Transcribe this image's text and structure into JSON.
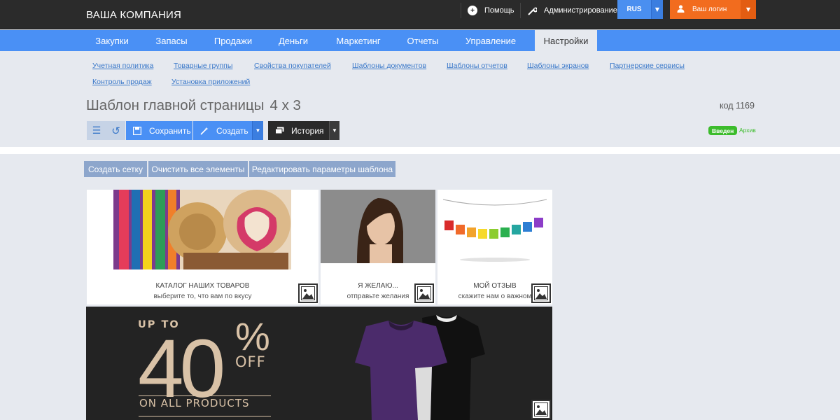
{
  "topbar": {
    "brand": "ВАША КОМПАНИЯ",
    "help_label": "Помощь",
    "admin_label": "Администрирование",
    "lang_label": "RUS",
    "login_label": "Ваш логин"
  },
  "nav": {
    "items": [
      {
        "label": "Закупки"
      },
      {
        "label": "Запасы"
      },
      {
        "label": "Продажи"
      },
      {
        "label": "Деньги"
      },
      {
        "label": "Маркетинг"
      },
      {
        "label": "Отчеты"
      },
      {
        "label": "Управление"
      },
      {
        "label": "Настройки",
        "active": true
      }
    ]
  },
  "subnav": {
    "links": [
      "Учетная политика",
      "Товарные группы",
      "Свойства покупателей",
      "Шаблоны документов",
      "Шаблоны отчетов",
      "Шаблоны экранов",
      "Партнерские сервисы",
      "Контроль продаж",
      "Установка приложений"
    ]
  },
  "page": {
    "title": "Шаблон главной страницы",
    "grid": "4 x 3",
    "code": "код 1169"
  },
  "toolbar": {
    "save_label": "Сохранить",
    "create_label": "Создать",
    "history_label": "История"
  },
  "status": {
    "badge": "Введен",
    "archive": "Архив"
  },
  "actions": {
    "create_grid": "Создать сетку",
    "clear_all": "Очистить все элементы",
    "edit_params": "Редактировать параметры шаблона"
  },
  "tiles": [
    {
      "title": "КАТАЛОГ НАШИХ ТОВАРОВ",
      "subtitle": "выберите то, что вам по вкусу"
    },
    {
      "title": "Я ЖЕЛАЮ...",
      "subtitle": "отправьте желания"
    },
    {
      "title": "МОЙ ОТЗЫВ",
      "subtitle": "скажите нам о важном"
    }
  ],
  "banner": {
    "upto": "UP TO",
    "number": "40",
    "percent": "%",
    "off": "OFF",
    "tagline": "ON ALL PRODUCTS"
  },
  "colors": {
    "topbar": "#2b2b2b",
    "nav": "#4a90f5",
    "login": "#f26c1e",
    "status_green": "#3cbc2c",
    "action_button": "#8da6cc"
  }
}
